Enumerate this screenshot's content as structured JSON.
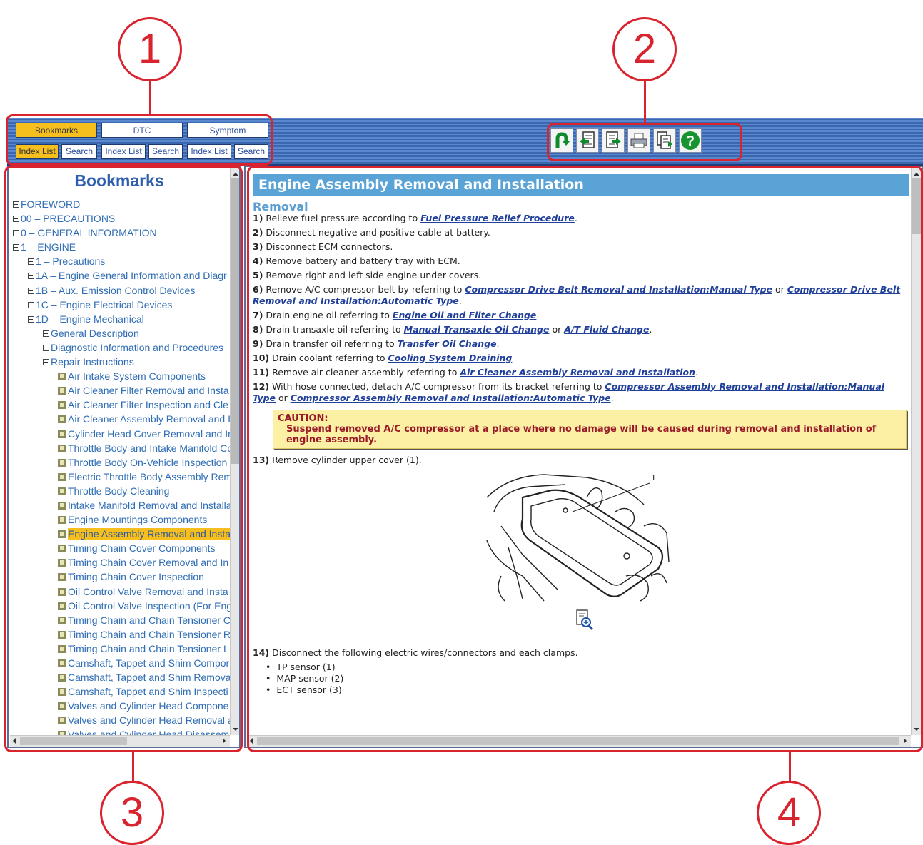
{
  "tabs": [
    {
      "label": "Bookmarks",
      "active": true
    },
    {
      "label": "DTC",
      "active": false
    },
    {
      "label": "Symptom",
      "active": false
    }
  ],
  "subtabs": [
    {
      "label": "Index List",
      "active": true
    },
    {
      "label": "Search",
      "active": false
    },
    {
      "label": "Index List",
      "active": false
    },
    {
      "label": "Search",
      "active": false
    },
    {
      "label": "Index List",
      "active": false
    },
    {
      "label": "Search",
      "active": false
    }
  ],
  "toolbar": {
    "icons": [
      "back-icon",
      "previous-page-icon",
      "next-page-icon",
      "print-icon",
      "copy-icon",
      "help-icon"
    ]
  },
  "bookmarks": {
    "title": "Bookmarks",
    "items": [
      {
        "label": "FOREWORD",
        "level": 0,
        "kind": "plus"
      },
      {
        "label": "00 – PRECAUTIONS",
        "level": 0,
        "kind": "plus"
      },
      {
        "label": "0 – GENERAL INFORMATION",
        "level": 0,
        "kind": "plus"
      },
      {
        "label": "1 – ENGINE",
        "level": 0,
        "kind": "minus"
      },
      {
        "label": "1 – Precautions",
        "level": 1,
        "kind": "plus"
      },
      {
        "label": "1A – Engine General Information and Diagr",
        "level": 1,
        "kind": "plus"
      },
      {
        "label": "1B – Aux. Emission Control Devices",
        "level": 1,
        "kind": "plus"
      },
      {
        "label": "1C – Engine Electrical Devices",
        "level": 1,
        "kind": "plus"
      },
      {
        "label": "1D – Engine Mechanical",
        "level": 1,
        "kind": "minus"
      },
      {
        "label": "General Description",
        "level": 2,
        "kind": "plus"
      },
      {
        "label": "Diagnostic Information and Procedures",
        "level": 2,
        "kind": "plus"
      },
      {
        "label": "Repair Instructions",
        "level": 2,
        "kind": "minus"
      },
      {
        "label": "Air Intake System Components",
        "level": 3,
        "kind": "doc"
      },
      {
        "label": "Air Cleaner Filter Removal and Insta",
        "level": 3,
        "kind": "doc"
      },
      {
        "label": "Air Cleaner Filter Inspection and Cle",
        "level": 3,
        "kind": "doc"
      },
      {
        "label": "Air Cleaner Assembly Removal and I",
        "level": 3,
        "kind": "doc"
      },
      {
        "label": "Cylinder Head Cover Removal and In",
        "level": 3,
        "kind": "doc"
      },
      {
        "label": "Throttle Body and Intake Manifold Co",
        "level": 3,
        "kind": "doc"
      },
      {
        "label": "Throttle Body On-Vehicle Inspection",
        "level": 3,
        "kind": "doc"
      },
      {
        "label": "Electric Throttle Body Assembly Rem",
        "level": 3,
        "kind": "doc"
      },
      {
        "label": "Throttle Body Cleaning",
        "level": 3,
        "kind": "doc"
      },
      {
        "label": "Intake Manifold Removal and Installa",
        "level": 3,
        "kind": "doc"
      },
      {
        "label": "Engine Mountings Components",
        "level": 3,
        "kind": "doc"
      },
      {
        "label": "Engine Assembly Removal and Insta",
        "level": 3,
        "kind": "doc",
        "selected": true
      },
      {
        "label": "Timing Chain Cover Components",
        "level": 3,
        "kind": "doc"
      },
      {
        "label": "Timing Chain Cover Removal and In",
        "level": 3,
        "kind": "doc"
      },
      {
        "label": "Timing Chain Cover Inspection",
        "level": 3,
        "kind": "doc"
      },
      {
        "label": "Oil Control Valve Removal and Insta",
        "level": 3,
        "kind": "doc"
      },
      {
        "label": "Oil Control Valve Inspection (For Eng",
        "level": 3,
        "kind": "doc"
      },
      {
        "label": "Timing Chain and Chain Tensioner C",
        "level": 3,
        "kind": "doc"
      },
      {
        "label": "Timing Chain and Chain Tensioner R",
        "level": 3,
        "kind": "doc"
      },
      {
        "label": "Timing Chain and Chain Tensioner I",
        "level": 3,
        "kind": "doc"
      },
      {
        "label": "Camshaft, Tappet and Shim Compor",
        "level": 3,
        "kind": "doc"
      },
      {
        "label": "Camshaft, Tappet and Shim Remova",
        "level": 3,
        "kind": "doc"
      },
      {
        "label": "Camshaft, Tappet and Shim Inspecti",
        "level": 3,
        "kind": "doc"
      },
      {
        "label": "Valves and Cylinder Head Compone",
        "level": 3,
        "kind": "doc"
      },
      {
        "label": "Valves and Cylinder Head Removal a",
        "level": 3,
        "kind": "doc"
      },
      {
        "label": "Valves and Cylinder Head Disassem",
        "level": 3,
        "kind": "doc"
      }
    ]
  },
  "document": {
    "title": "Engine Assembly Removal and Installation",
    "section": "Removal",
    "steps": [
      {
        "num": "1)",
        "parts": [
          {
            "t": "Relieve fuel pressure according to "
          },
          {
            "l": "Fuel Pressure Relief Procedure"
          },
          {
            "t": "."
          }
        ]
      },
      {
        "num": "2)",
        "parts": [
          {
            "t": "Disconnect negative and positive cable at battery."
          }
        ]
      },
      {
        "num": "3)",
        "parts": [
          {
            "t": "Disconnect ECM connectors."
          }
        ]
      },
      {
        "num": "4)",
        "parts": [
          {
            "t": "Remove battery and battery tray with ECM."
          }
        ]
      },
      {
        "num": "5)",
        "parts": [
          {
            "t": "Remove right and left side engine under covers."
          }
        ]
      },
      {
        "num": "6)",
        "parts": [
          {
            "t": "Remove A/C compressor belt by referring to "
          },
          {
            "l": "Compressor Drive Belt Removal and Installation:Manual Type"
          },
          {
            "t": " or "
          },
          {
            "l": "Compressor Drive Belt Removal and Installation:Automatic Type"
          },
          {
            "t": "."
          }
        ]
      },
      {
        "num": "7)",
        "parts": [
          {
            "t": "Drain engine oil referring to "
          },
          {
            "l": "Engine Oil and Filter Change"
          },
          {
            "t": "."
          }
        ]
      },
      {
        "num": "8)",
        "parts": [
          {
            "t": "Drain transaxle oil referring to "
          },
          {
            "l": "Manual Transaxle Oil Change"
          },
          {
            "t": " or "
          },
          {
            "l": "A/T Fluid Change"
          },
          {
            "t": "."
          }
        ]
      },
      {
        "num": "9)",
        "parts": [
          {
            "t": "Drain transfer oil referring to "
          },
          {
            "l": "Transfer Oil Change"
          },
          {
            "t": "."
          }
        ]
      },
      {
        "num": "10)",
        "parts": [
          {
            "t": "Drain coolant referring to "
          },
          {
            "l": "Cooling System Draining"
          }
        ]
      },
      {
        "num": "11)",
        "parts": [
          {
            "t": "Remove air cleaner assembly referring to "
          },
          {
            "l": "Air Cleaner Assembly Removal and Installation"
          },
          {
            "t": "."
          }
        ]
      },
      {
        "num": "12)",
        "parts": [
          {
            "t": "With hose connected, detach A/C compressor from its bracket referring to "
          },
          {
            "l": "Compressor Assembly Removal and Installation:Manual Type"
          },
          {
            "t": " or "
          },
          {
            "l": "Compressor Assembly Removal and Installation:Automatic Type"
          },
          {
            "t": "."
          }
        ]
      }
    ],
    "caution_title": "CAUTION:",
    "caution_body": "Suspend removed A/C compressor at a place where no damage will be caused during removal and installation of engine assembly.",
    "step13": {
      "num": "13)",
      "text": "Remove cylinder upper cover (1)."
    },
    "figure_label": "1",
    "step14": {
      "num": "14)",
      "text": "Disconnect the following electric wires/connectors and each clamps."
    },
    "bullets": [
      "TP sensor (1)",
      "MAP sensor (2)",
      "ECT sensor (3)"
    ]
  },
  "annotations": [
    "1",
    "2",
    "3",
    "4"
  ],
  "colors": {
    "accent": "#f6bf1d",
    "callout": "#d9232e",
    "title_bar": "#5aa3d6",
    "topbar": "#3a67b0"
  }
}
